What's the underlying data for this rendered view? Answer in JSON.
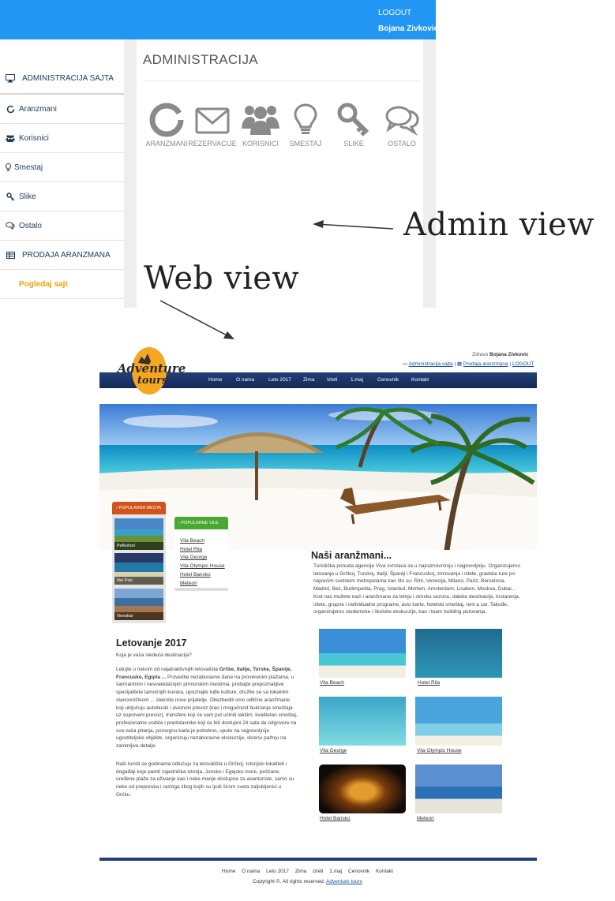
{
  "admin": {
    "topbar": {
      "logout": "LOGOUT",
      "user": "Bojana Zivkovic"
    },
    "title": "ADMINISTRACIJA",
    "tiles": [
      {
        "label": "ARANZMANI",
        "icon": "circle-notch-icon"
      },
      {
        "label": "REZERVACIJE",
        "icon": "envelope-icon"
      },
      {
        "label": "KORISNICI",
        "icon": "users-icon"
      },
      {
        "label": "SMESTAJ",
        "icon": "lightbulb-icon"
      },
      {
        "label": "SLIKE",
        "icon": "key-icon"
      },
      {
        "label": "OSTALO",
        "icon": "comments-icon"
      }
    ],
    "sidebar": [
      {
        "label": "ADMINISTRACIJA SAJTA",
        "icon": "desktop-icon"
      },
      {
        "label": "Aranzmani",
        "icon": "circle-notch-icon"
      },
      {
        "label": "Korisnici",
        "icon": "users-icon"
      },
      {
        "label": "Smestaj",
        "icon": "lightbulb-icon"
      },
      {
        "label": "Slike",
        "icon": "key-icon"
      },
      {
        "label": "Ostalo",
        "icon": "comments-icon"
      },
      {
        "label": "PRODAJA ARANZMANA",
        "icon": "table-icon"
      },
      {
        "label": "Pogledaj sajt",
        "icon": ""
      }
    ]
  },
  "annotations": {
    "admin": "Admin view",
    "web": "Web view"
  },
  "web": {
    "header": {
      "greeting": "Zdravo",
      "user": "Bojana Zivkovic",
      "link_admin": "Administracija sajta",
      "link_sales": "Prodaja aranzmana",
      "link_logout": "LOGOUT",
      "logo_line1": "Adventure",
      "logo_line2": "tours"
    },
    "nav": [
      "Home",
      "O nama",
      "Leto 2017",
      "Zima",
      "Izleti",
      "1.maj",
      "Cenovnik",
      "Kontakt"
    ],
    "popular_places": {
      "tab": "POPULARNA MESTA",
      "items": [
        "Pefkohori",
        "Nei Pori",
        "Nesebar"
      ]
    },
    "popular_villas": {
      "tab": "POPULARNE VILE",
      "items": [
        "Vila Beach",
        "Hotel Rila",
        "Vila George",
        "Vila Olympic House",
        "Hotel Bansko",
        "Meteori"
      ]
    },
    "offers": {
      "title": "Naši aranžmani...",
      "text": "Turistička ponuda agencije Viva svrstava se u najraznovrsniju i najpovoljniju. Organizujemo letovanja u Grčkoj, Turskoj, Italiji, Španiji i Francuskoj, zimovanja i izlete, gradske ture po najvećim svetskim metropolama kao što su: Rim, Venecija, Milano, Pariz, Barselona, Madrid, Beč, Budimpešta, Prag, Istanbul, Minhen, Amsterdam, Lisabon, Moskva, Dubai... Kod nas možete naći i aranžmane za letnju i zimsku sezonu, daleke destinacije, krstarenja, izlete, grupne i individualne programe, avio karte, hotelski smeštaj, rent a car. Takođe, organizujemo studentske i školske ekskurzije, kao i team building putovanja."
    },
    "summer": {
      "title": "Letovanje 2017",
      "subtitle": "Koja je vaša sledeća destinacija?",
      "p1_intro": "Letujte u nekom od najatraktivnijih letovališta ",
      "p1_bold": "Grčke, Italije, Turske, Španije, Francuske, Egipta ...",
      "p1_rest": " Provedite nezaboravne dane na proverenim plažama, u šarmantnim i nesvakidašnjim primorskim mestima, probajte prepoznatljive specijalitete tamošnjih kuvara, upoznajte tuđe kulture, družite se sa lokalnim stanovništvom ... steknite nove prijatelje. Obezbedili smo odlične aranžmane koji uključuju autobuski i avionski prevoz (kao i mogućnost bukiranja smeštaja uz sopstveni prevoz), transfere koji će vam put učiniti lakšim, kvalitetan smeštaj, profesionalne vodiče i predstavnike koji će biti dostupni 24 sata da odgovore na sva vaša pitanja, pomognu kada je potrebno, upute na najpovoljnije ugostiteljske objekte, organizuju nezaboravne ekskurzije, skrenu pažnju na zanimljive detalje.",
      "p2": "Naši turisti se godinama odlučuju za letovališta u Grčkoj. Istorijski lokaliteti i događaji koje pamti zajednička istorija, Jonsko i Egejsko more, peščane, uređene plaže za uživanje kao i neke manje dostupne za avanturiste, samo su neke od preporuka i razloga zbog kojih su ljudi širom sveta zaljubljenici u Grčku."
    },
    "gallery": [
      "Vila Beach",
      "Hotel Rila",
      "Vila George",
      "Vila Olympic House",
      "Hotel Bansko",
      "Meteori"
    ],
    "footer": {
      "nav": [
        "Home",
        "O nama",
        "Leto 2017",
        "Zima",
        "Izleti",
        "1.maj",
        "Cenovnik",
        "Kontakt"
      ],
      "copyright": "Copyright ©. All rights reserved.",
      "brand": "Adventure tours"
    }
  }
}
